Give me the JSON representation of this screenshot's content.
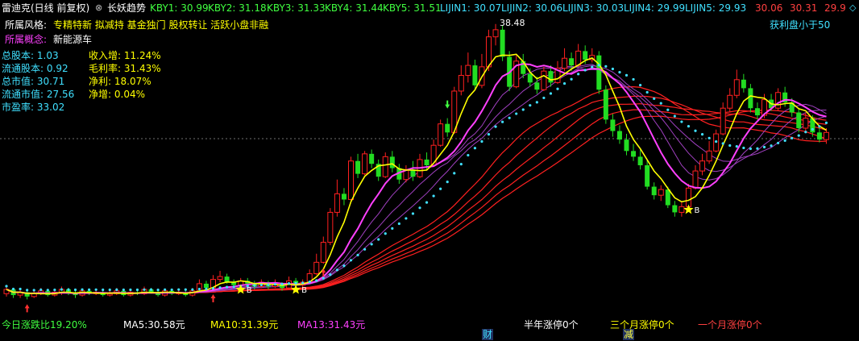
{
  "colors": {
    "bg": "#000000",
    "up": "#ff2020",
    "down": "#22dd22",
    "ma5": "#ffff00",
    "ma10": "#ff40ff",
    "ma_dots": "#40e0ff",
    "long": "#ff2020",
    "label": "#ffffff",
    "kby": "#40ff40",
    "lijin": "#40e0ff",
    "jdz": "#ff4040"
  },
  "header": {
    "stock_title": "雷迪克(日线 前复权)",
    "indicator_name": "长妖趋势",
    "kby": [
      "KBY1: 30.99",
      "KBY2: 31.18",
      "KBY3: 31.33",
      "KBY4: 31.44",
      "KBY5: 31.51"
    ],
    "lijin": [
      "LIJIN1: 30.07",
      "LIJIN2: 30.06",
      "LIJIN3: 30.03",
      "LIJIN4: 29.99",
      "LIJIN5: 29.93"
    ],
    "jdz": [
      "30.06",
      "30.31",
      "29.9"
    ]
  },
  "info": {
    "style_label": "所属风格:",
    "style_value": "专精特新 拟减持 基金独门 股权转让 活跃小盘非融",
    "concept_label": "所属概念:",
    "concept_value": "新能源车",
    "fundamentals": [
      {
        "label": "总股本",
        "value": "1.03"
      },
      {
        "label": "流通股本",
        "value": "0.92"
      },
      {
        "label": "总市值",
        "value": "30.71"
      },
      {
        "label": "流通市值",
        "value": "27.56"
      },
      {
        "label": "市盈率",
        "value": "33.02"
      }
    ],
    "growth": [
      {
        "label": "收入增",
        "value": "11.24%"
      },
      {
        "label": "毛利率",
        "value": "31.43%"
      },
      {
        "label": "净利",
        "value": "18.07%"
      },
      {
        "label": "净增",
        "value": "0.04%"
      }
    ]
  },
  "annotations": {
    "profit_note": "获利盘小于50",
    "peak_price": "38.48",
    "b_label": "B"
  },
  "footer": {
    "today_change": "今日涨跌比19.20%",
    "ma5": "MA5:30.58元",
    "ma10": "MA10:31.39元",
    "ma13": "MA13:31.43元",
    "half_year": "半年涨停0个",
    "three_months": "三个月涨停0个",
    "one_month": "一个月涨停0个",
    "marker_cai": "财",
    "marker_jian": "减"
  },
  "chart_data": {
    "type": "candlestick",
    "peak": 38.48,
    "candles": [
      {
        "o": 19.6,
        "c": 19.9,
        "h": 20.1,
        "l": 19.4
      },
      {
        "o": 19.9,
        "c": 19.5,
        "h": 20.0,
        "l": 19.3
      },
      {
        "o": 19.5,
        "c": 19.7,
        "h": 19.9,
        "l": 19.3
      },
      {
        "o": 19.7,
        "c": 19.4,
        "h": 19.8,
        "l": 19.2
      },
      {
        "o": 19.4,
        "c": 19.6,
        "h": 19.8,
        "l": 19.3
      },
      {
        "o": 19.6,
        "c": 19.8,
        "h": 20.0,
        "l": 19.5
      },
      {
        "o": 19.8,
        "c": 19.5,
        "h": 19.9,
        "l": 19.4
      },
      {
        "o": 19.5,
        "c": 19.7,
        "h": 19.9,
        "l": 19.4
      },
      {
        "o": 19.7,
        "c": 19.9,
        "h": 20.1,
        "l": 19.5
      },
      {
        "o": 19.9,
        "c": 19.6,
        "h": 20.0,
        "l": 19.5
      },
      {
        "o": 19.6,
        "c": 19.5,
        "h": 19.8,
        "l": 19.3
      },
      {
        "o": 19.5,
        "c": 19.8,
        "h": 19.9,
        "l": 19.4
      },
      {
        "o": 19.8,
        "c": 19.6,
        "h": 19.9,
        "l": 19.5
      },
      {
        "o": 19.6,
        "c": 19.7,
        "h": 19.9,
        "l": 19.5
      },
      {
        "o": 19.7,
        "c": 19.5,
        "h": 19.8,
        "l": 19.4
      },
      {
        "o": 19.5,
        "c": 19.6,
        "h": 19.8,
        "l": 19.4
      },
      {
        "o": 19.6,
        "c": 19.8,
        "h": 20.0,
        "l": 19.5
      },
      {
        "o": 19.8,
        "c": 19.5,
        "h": 19.9,
        "l": 19.4
      },
      {
        "o": 19.5,
        "c": 19.7,
        "h": 19.8,
        "l": 19.4
      },
      {
        "o": 19.7,
        "c": 19.6,
        "h": 19.9,
        "l": 19.5
      },
      {
        "o": 19.6,
        "c": 19.9,
        "h": 20.1,
        "l": 19.5
      },
      {
        "o": 19.9,
        "c": 19.7,
        "h": 20.0,
        "l": 19.6
      },
      {
        "o": 19.7,
        "c": 19.5,
        "h": 19.8,
        "l": 19.4
      },
      {
        "o": 19.5,
        "c": 19.8,
        "h": 19.9,
        "l": 19.4
      },
      {
        "o": 19.8,
        "c": 19.6,
        "h": 19.9,
        "l": 19.5
      },
      {
        "o": 19.6,
        "c": 19.7,
        "h": 19.9,
        "l": 19.5
      },
      {
        "o": 19.7,
        "c": 19.5,
        "h": 19.8,
        "l": 19.4
      },
      {
        "o": 19.5,
        "c": 19.8,
        "h": 20.0,
        "l": 19.4
      },
      {
        "o": 19.8,
        "c": 20.3,
        "h": 20.6,
        "l": 19.7
      },
      {
        "o": 20.3,
        "c": 20.0,
        "h": 20.5,
        "l": 19.9
      },
      {
        "o": 20.0,
        "c": 20.6,
        "h": 20.9,
        "l": 19.9
      },
      {
        "o": 20.6,
        "c": 20.8,
        "h": 21.2,
        "l": 20.4
      },
      {
        "o": 20.8,
        "c": 20.4,
        "h": 21.0,
        "l": 20.3
      },
      {
        "o": 20.4,
        "c": 20.2,
        "h": 20.6,
        "l": 20.0
      },
      {
        "o": 20.2,
        "c": 20.5,
        "h": 20.7,
        "l": 20.0
      },
      {
        "o": 20.5,
        "c": 20.3,
        "h": 20.7,
        "l": 20.1
      },
      {
        "o": 20.3,
        "c": 20.1,
        "h": 20.5,
        "l": 19.9
      },
      {
        "o": 20.1,
        "c": 20.4,
        "h": 20.6,
        "l": 20.0
      },
      {
        "o": 20.4,
        "c": 20.1,
        "h": 20.5,
        "l": 19.9
      },
      {
        "o": 20.1,
        "c": 20.3,
        "h": 20.6,
        "l": 20.0
      },
      {
        "o": 20.3,
        "c": 20.0,
        "h": 20.4,
        "l": 19.8
      },
      {
        "o": 20.0,
        "c": 20.5,
        "h": 20.8,
        "l": 19.9
      },
      {
        "o": 20.5,
        "c": 20.2,
        "h": 20.7,
        "l": 20.0
      },
      {
        "o": 20.2,
        "c": 20.4,
        "h": 20.6,
        "l": 20.0
      },
      {
        "o": 20.4,
        "c": 21.0,
        "h": 21.3,
        "l": 20.3
      },
      {
        "o": 21.0,
        "c": 21.8,
        "h": 22.4,
        "l": 20.9
      },
      {
        "o": 21.8,
        "c": 23.2,
        "h": 23.6,
        "l": 21.7
      },
      {
        "o": 23.2,
        "c": 25.3,
        "h": 25.6,
        "l": 23.0
      },
      {
        "o": 25.3,
        "c": 26.6,
        "h": 27.6,
        "l": 25.0
      },
      {
        "o": 26.6,
        "c": 26.2,
        "h": 27.0,
        "l": 25.8
      },
      {
        "o": 26.2,
        "c": 28.9,
        "h": 29.2,
        "l": 26.1
      },
      {
        "o": 28.9,
        "c": 28.0,
        "h": 29.4,
        "l": 27.7
      },
      {
        "o": 28.0,
        "c": 29.4,
        "h": 29.6,
        "l": 27.9
      },
      {
        "o": 29.4,
        "c": 28.7,
        "h": 29.7,
        "l": 28.4
      },
      {
        "o": 28.7,
        "c": 27.8,
        "h": 29.0,
        "l": 27.5
      },
      {
        "o": 27.8,
        "c": 29.2,
        "h": 29.5,
        "l": 27.7
      },
      {
        "o": 29.2,
        "c": 28.4,
        "h": 29.6,
        "l": 28.1
      },
      {
        "o": 28.4,
        "c": 27.6,
        "h": 28.7,
        "l": 27.3
      },
      {
        "o": 27.6,
        "c": 28.3,
        "h": 28.6,
        "l": 27.4
      },
      {
        "o": 28.3,
        "c": 27.8,
        "h": 28.9,
        "l": 27.5
      },
      {
        "o": 27.8,
        "c": 29.0,
        "h": 29.4,
        "l": 27.7
      },
      {
        "o": 29.0,
        "c": 28.6,
        "h": 29.5,
        "l": 28.3
      },
      {
        "o": 28.6,
        "c": 30.0,
        "h": 30.4,
        "l": 28.5
      },
      {
        "o": 30.0,
        "c": 31.5,
        "h": 31.8,
        "l": 29.9
      },
      {
        "o": 31.5,
        "c": 30.9,
        "h": 31.9,
        "l": 30.6
      },
      {
        "o": 30.9,
        "c": 33.8,
        "h": 34.1,
        "l": 30.8
      },
      {
        "o": 33.8,
        "c": 34.9,
        "h": 35.6,
        "l": 33.5
      },
      {
        "o": 34.9,
        "c": 35.6,
        "h": 36.5,
        "l": 34.4
      },
      {
        "o": 35.6,
        "c": 34.2,
        "h": 36.0,
        "l": 33.9
      },
      {
        "o": 34.2,
        "c": 35.5,
        "h": 36.4,
        "l": 34.0
      },
      {
        "o": 35.5,
        "c": 37.6,
        "h": 38.1,
        "l": 35.2
      },
      {
        "o": 37.6,
        "c": 38.1,
        "h": 38.5,
        "l": 37.0
      },
      {
        "o": 38.1,
        "c": 36.2,
        "h": 38.4,
        "l": 35.9
      },
      {
        "o": 36.2,
        "c": 34.1,
        "h": 36.6,
        "l": 33.8
      },
      {
        "o": 34.1,
        "c": 35.9,
        "h": 36.3,
        "l": 34.0
      },
      {
        "o": 35.9,
        "c": 35.0,
        "h": 36.4,
        "l": 34.7
      },
      {
        "o": 35.0,
        "c": 34.4,
        "h": 35.4,
        "l": 34.1
      },
      {
        "o": 34.4,
        "c": 33.9,
        "h": 34.8,
        "l": 33.6
      },
      {
        "o": 33.9,
        "c": 35.2,
        "h": 35.5,
        "l": 33.8
      },
      {
        "o": 35.2,
        "c": 34.4,
        "h": 35.6,
        "l": 34.1
      },
      {
        "o": 34.4,
        "c": 35.4,
        "h": 35.9,
        "l": 34.3
      },
      {
        "o": 35.4,
        "c": 36.1,
        "h": 36.8,
        "l": 35.2
      },
      {
        "o": 36.1,
        "c": 35.6,
        "h": 36.5,
        "l": 35.2
      },
      {
        "o": 35.6,
        "c": 36.6,
        "h": 37.1,
        "l": 35.5
      },
      {
        "o": 36.6,
        "c": 36.0,
        "h": 37.0,
        "l": 35.7
      },
      {
        "o": 36.0,
        "c": 36.3,
        "h": 36.8,
        "l": 35.8
      },
      {
        "o": 36.3,
        "c": 33.9,
        "h": 36.6,
        "l": 33.6
      },
      {
        "o": 33.9,
        "c": 31.8,
        "h": 34.2,
        "l": 31.5
      },
      {
        "o": 31.8,
        "c": 31.0,
        "h": 32.2,
        "l": 30.6
      },
      {
        "o": 31.0,
        "c": 30.4,
        "h": 31.4,
        "l": 30.1
      },
      {
        "o": 30.4,
        "c": 29.6,
        "h": 30.8,
        "l": 29.3
      },
      {
        "o": 29.6,
        "c": 29.2,
        "h": 30.1,
        "l": 28.9
      },
      {
        "o": 29.2,
        "c": 28.6,
        "h": 29.7,
        "l": 28.3
      },
      {
        "o": 28.6,
        "c": 27.1,
        "h": 29.0,
        "l": 26.9
      },
      {
        "o": 27.1,
        "c": 26.5,
        "h": 27.4,
        "l": 26.2
      },
      {
        "o": 26.5,
        "c": 26.9,
        "h": 27.2,
        "l": 26.1
      },
      {
        "o": 26.9,
        "c": 25.8,
        "h": 27.1,
        "l": 25.6
      },
      {
        "o": 25.8,
        "c": 25.3,
        "h": 26.1,
        "l": 25.0
      },
      {
        "o": 25.3,
        "c": 25.7,
        "h": 26.0,
        "l": 25.0
      },
      {
        "o": 25.7,
        "c": 27.0,
        "h": 27.3,
        "l": 25.6
      },
      {
        "o": 27.0,
        "c": 28.2,
        "h": 28.6,
        "l": 26.9
      },
      {
        "o": 28.2,
        "c": 28.9,
        "h": 29.4,
        "l": 27.9
      },
      {
        "o": 28.9,
        "c": 29.6,
        "h": 30.3,
        "l": 28.7
      },
      {
        "o": 29.6,
        "c": 30.8,
        "h": 31.1,
        "l": 29.5
      },
      {
        "o": 30.8,
        "c": 32.6,
        "h": 33.0,
        "l": 30.7
      },
      {
        "o": 32.6,
        "c": 33.5,
        "h": 34.0,
        "l": 32.3
      },
      {
        "o": 33.5,
        "c": 34.6,
        "h": 35.3,
        "l": 33.3
      },
      {
        "o": 34.6,
        "c": 34.0,
        "h": 35.0,
        "l": 33.7
      },
      {
        "o": 34.0,
        "c": 32.6,
        "h": 34.3,
        "l": 32.3
      },
      {
        "o": 32.6,
        "c": 32.1,
        "h": 33.0,
        "l": 31.8
      },
      {
        "o": 32.1,
        "c": 33.2,
        "h": 33.6,
        "l": 31.9
      },
      {
        "o": 33.2,
        "c": 32.6,
        "h": 33.6,
        "l": 32.4
      },
      {
        "o": 32.6,
        "c": 33.7,
        "h": 34.0,
        "l": 32.4
      },
      {
        "o": 33.7,
        "c": 33.0,
        "h": 34.1,
        "l": 32.7
      },
      {
        "o": 33.0,
        "c": 32.3,
        "h": 33.3,
        "l": 32.0
      },
      {
        "o": 32.3,
        "c": 31.2,
        "h": 32.6,
        "l": 30.9
      },
      {
        "o": 31.2,
        "c": 31.9,
        "h": 32.3,
        "l": 31.0
      },
      {
        "o": 31.9,
        "c": 30.9,
        "h": 32.1,
        "l": 30.6
      },
      {
        "o": 30.9,
        "c": 30.4,
        "h": 31.2,
        "l": 30.2
      },
      {
        "o": 30.4,
        "c": 30.9,
        "h": 31.2,
        "l": 30.1
      }
    ]
  }
}
